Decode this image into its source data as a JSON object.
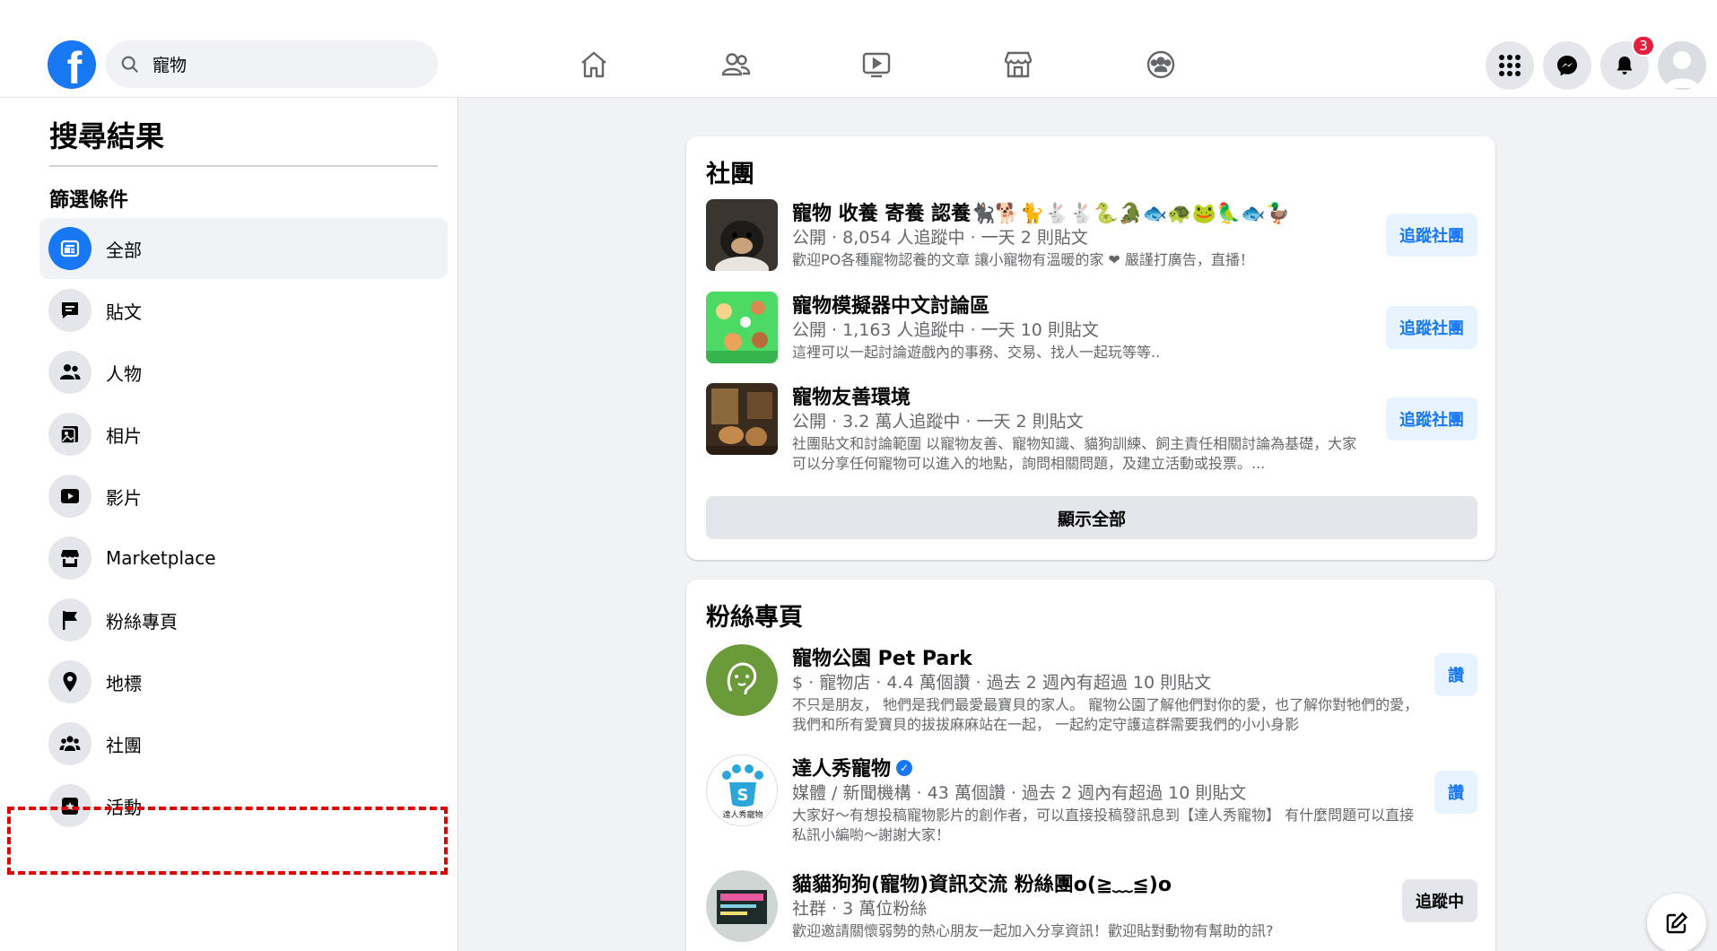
{
  "topbar": {
    "logo_letter": "f",
    "search_value": "寵物",
    "notification_count": "3",
    "nav_icons": [
      "home-icon",
      "friends-icon",
      "watch-icon",
      "marketplace-icon",
      "groups-icon"
    ],
    "right_icons": [
      "menu-grid-icon",
      "messenger-icon",
      "bell-icon",
      "avatar"
    ]
  },
  "sidebar": {
    "title": "搜尋結果",
    "filter_heading": "篩選條件",
    "items": [
      {
        "label": "全部",
        "icon": "all-results-icon",
        "active": true
      },
      {
        "label": "貼文",
        "icon": "posts-icon"
      },
      {
        "label": "人物",
        "icon": "people-icon"
      },
      {
        "label": "相片",
        "icon": "photos-icon"
      },
      {
        "label": "影片",
        "icon": "videos-icon"
      },
      {
        "label": "Marketplace",
        "icon": "marketplace-icon"
      },
      {
        "label": "粉絲專頁",
        "icon": "flag-icon"
      },
      {
        "label": "地標",
        "icon": "location-pin-icon"
      },
      {
        "label": "社團",
        "icon": "groups-icon",
        "highlighted": true
      },
      {
        "label": "活動",
        "icon": "event-icon"
      }
    ]
  },
  "groups_card": {
    "title": "社團",
    "show_all": "顯示全部",
    "rows": [
      {
        "name": "寵物 收養 寄養 認養🐈‍⬛🐕🐈🐇🐇🐍🐊🐟🐢🐸🦜🐟🦆",
        "meta": "公開 · 8,054 人追蹤中 · 一天 2 則貼文",
        "desc": "歡迎PO各種寵物認養的文章 讓小寵物有溫暖的家 ❤ 嚴謹打廣告，直播！",
        "button": "追蹤社團"
      },
      {
        "name": "寵物模擬器中文討論區",
        "meta": "公開 · 1,163 人追蹤中 · 一天 10 則貼文",
        "desc": "這裡可以一起討論遊戲內的事務、交易、找人一起玩等等..",
        "button": "追蹤社團"
      },
      {
        "name": "寵物友善環境",
        "meta": "公開 · 3.2 萬人追蹤中 · 一天 2 則貼文",
        "desc": "社團貼文和討論範圍 以寵物友善、寵物知識、貓狗訓練、飼主責任相關討論為基礎，大家可以分享任何寵物可以進入的地點，詢問相關問題，及建立活動或投票。...",
        "button": "追蹤社團"
      }
    ]
  },
  "pages_card": {
    "title": "粉絲專頁",
    "rows": [
      {
        "name": "寵物公園 Pet Park",
        "meta": "$ · 寵物店 · 4.4 萬個讚 · 過去 2 週內有超過 10 則貼文",
        "desc": "不只是朋友， 牠們是我們最愛最寶貝的家人。 寵物公園了解他們對你的愛，也了解你對牠們的愛， 我們和所有愛寶貝的拔拔麻麻站在一起， 一起約定守護這群需要我們的小小身影",
        "button": "讚"
      },
      {
        "name": "達人秀寵物",
        "verified": "✓",
        "meta": "媒體 / 新聞機構 · 43 萬個讚 · 過去 2 週內有超過 10 則貼文",
        "desc": "大家好～有想投稿寵物影片的創作者，可以直接投稿發訊息到【達人秀寵物】 有什麼問題可以直接私訊小編喲～謝謝大家！",
        "logo_text": "達人秀寵物",
        "logo_badge": "S",
        "button": "讚"
      },
      {
        "name": "貓貓狗狗(寵物)資訊交流 粉絲團o(≧﹏≦)o",
        "meta": "社群 · 3 萬位粉絲",
        "desc": "歡迎邀請關懷弱勢的熱心朋友一起加入分享資訊！歡迎貼對動物有幫助的訊?",
        "button": "追蹤中"
      }
    ]
  },
  "colors": {
    "brand_blue": "#1877f2",
    "follow_bg": "#e7f3ff",
    "badge_red": "#e41e3f",
    "highlight_red": "#e00000"
  }
}
